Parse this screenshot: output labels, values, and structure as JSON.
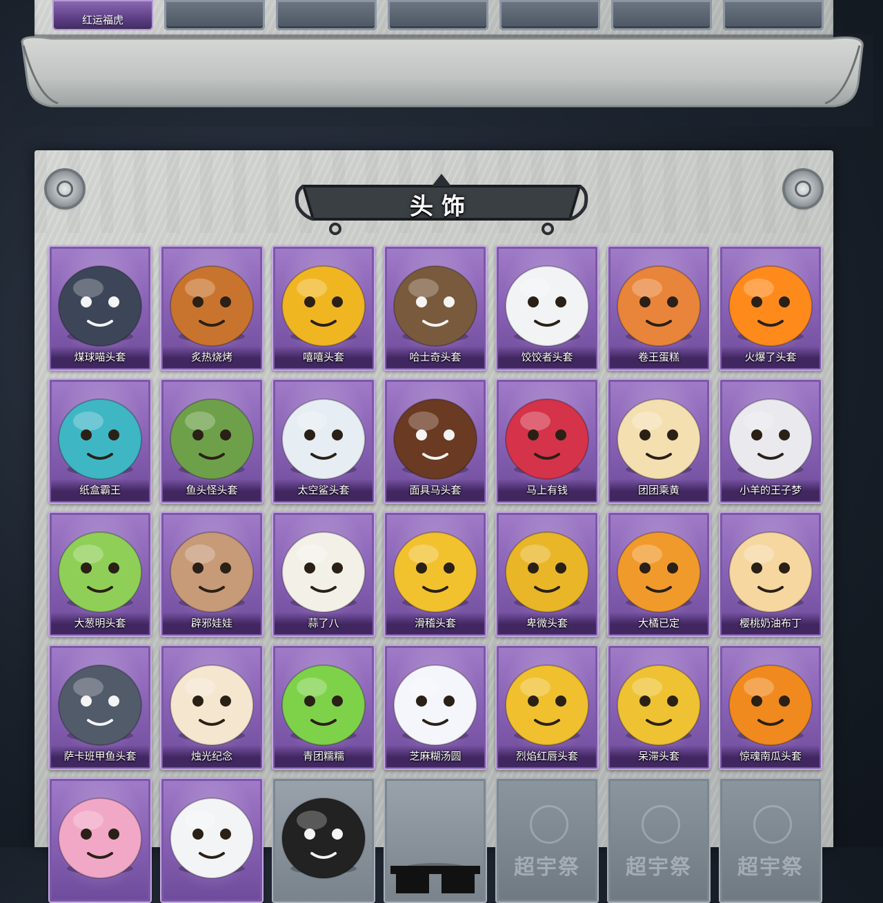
{
  "top_row": {
    "slots": [
      {
        "label": "红运福虎",
        "filled": true
      },
      {
        "label": "",
        "filled": false
      },
      {
        "label": "",
        "filled": false
      },
      {
        "label": "",
        "filled": false
      },
      {
        "label": "",
        "filled": false
      },
      {
        "label": "",
        "filled": false
      },
      {
        "label": "",
        "filled": false
      }
    ]
  },
  "section": {
    "title": "头饰"
  },
  "colors": {
    "card_purple": "#8a63b6",
    "card_grey": "#78828b",
    "stone": "#c4c7c4"
  },
  "items": [
    {
      "label": "煤球喵头套",
      "icon": "black-cat-mask",
      "face": "#3d4658"
    },
    {
      "label": "炙热烧烤",
      "icon": "grilled-meat-mask",
      "face": "#c9742e"
    },
    {
      "label": "嘻嘻头套",
      "icon": "grin-emoji-mask",
      "face": "#f0b622"
    },
    {
      "label": "哈士奇头套",
      "icon": "husky-mask",
      "face": "#7a5a3c"
    },
    {
      "label": "饺饺者头套",
      "icon": "dumpling-cloud-mask",
      "face": "#f1f3f4"
    },
    {
      "label": "卷王蛋糕",
      "icon": "roll-cake-mask",
      "face": "#e8853a"
    },
    {
      "label": "火爆了头套",
      "icon": "fire-mask",
      "face": "#ff8a1c"
    },
    {
      "label": "纸盒霸王",
      "icon": "cardboard-dino-mask",
      "face": "#3fb6c4"
    },
    {
      "label": "鱼头怪头套",
      "icon": "fish-head-mask",
      "face": "#6ea04a"
    },
    {
      "label": "太空鲨头套",
      "icon": "space-shark-mask",
      "face": "#e6edf3"
    },
    {
      "label": "面具马头套",
      "icon": "horse-mask",
      "face": "#6b3a22"
    },
    {
      "label": "马上有钱",
      "icon": "red-horse-mask",
      "face": "#d4334a"
    },
    {
      "label": "团团乘黄",
      "icon": "cream-cat-mask",
      "face": "#f4dfb0"
    },
    {
      "label": "小羊的王子梦",
      "icon": "sheep-prince-mask",
      "face": "#e9e9ee"
    },
    {
      "label": "大葱明头套",
      "icon": "green-onion-mask",
      "face": "#8fcf57"
    },
    {
      "label": "辟邪娃娃",
      "icon": "doll-head-mask",
      "face": "#c79a78"
    },
    {
      "label": "蒜了八",
      "icon": "garlic-mask",
      "face": "#f3f0e8"
    },
    {
      "label": "滑稽头套",
      "icon": "smirk-emoji-mask",
      "face": "#f2c12e"
    },
    {
      "label": "卑微头套",
      "icon": "humble-emoji-mask",
      "face": "#e8b627"
    },
    {
      "label": "大橘已定",
      "icon": "orange-slice-mask",
      "face": "#f19a2c"
    },
    {
      "label": "樱桃奶油布丁",
      "icon": "pudding-mask",
      "face": "#f6d7a0"
    },
    {
      "label": "萨卡班甲鱼头套",
      "icon": "sacabambaspis-mask",
      "face": "#525b6a"
    },
    {
      "label": "烛光纪念",
      "icon": "candle-mask",
      "face": "#f5e6cf"
    },
    {
      "label": "青团糯糯",
      "icon": "green-rice-ball-mask",
      "face": "#7ed24a"
    },
    {
      "label": "芝麻糊汤圆",
      "icon": "tangyuan-mask",
      "face": "#f4f6fb"
    },
    {
      "label": "烈焰红唇头套",
      "icon": "red-lips-pikachu-mask",
      "face": "#f0c02e"
    },
    {
      "label": "呆滞头套",
      "icon": "dazed-emoji-mask",
      "face": "#eec232"
    },
    {
      "label": "惊魂南瓜头套",
      "icon": "pumpkin-mask",
      "face": "#f08a1e"
    },
    {
      "label": "",
      "icon": "pink-bear-mask",
      "face": "#f1a7c6"
    },
    {
      "label": "",
      "icon": "snowman-deer-mask",
      "face": "#f3f4f6"
    },
    {
      "label": "",
      "icon": "helmet-mask",
      "face": "#222"
    },
    {
      "label": "",
      "icon": "pixel-sunglasses",
      "face": "#111"
    },
    {
      "label": "",
      "icon": "empty-slot",
      "face": "",
      "watermark": "超宇祭"
    },
    {
      "label": "",
      "icon": "empty-slot",
      "face": "",
      "watermark": "超宇祭"
    },
    {
      "label": "",
      "icon": "empty-slot",
      "face": "",
      "watermark": "超宇祭"
    }
  ]
}
